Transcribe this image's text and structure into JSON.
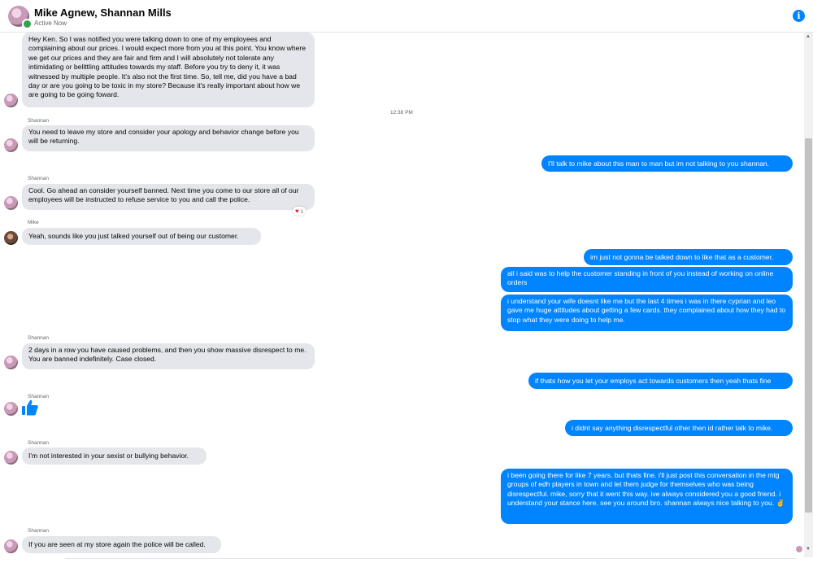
{
  "header": {
    "title": "Mike Agnew, Shannan Mills",
    "status": "Active Now",
    "info_icon": "info-icon"
  },
  "timestamp": "12:38 PM",
  "messages": {
    "m1": "Hey Ken. So I was notified you were talking down to one of my employees and complaining about our prices. I would expect more from you at this point. You know where we get our prices and they are fair and firm and I will absolutely not tolerate any intimidating or belittling attitudes towards my staff. Before you try to deny it, it was witnessed by multiple people. It's also not the first time. So, tell me, did you have a bad day or are you going to be toxic in my store? Because it's really important about how we are going to be going foward.",
    "m2_sender": "Shannan",
    "m2": "You need to leave my store and consider your apology and behavior change before you will be returning.",
    "m3": "I'll talk to mike about this man to man but im not talking to you shannan.",
    "m4_sender": "Shannan",
    "m4": "Cool. Go ahead an consider yourself banned. Next time you come to our store all of our employees will be instructed to refuse service to you and call the police.",
    "m4_reaction_count": "1",
    "m5_sender": "Mike",
    "m5": "Yeah, sounds like you just talked yourself out of being our customer.",
    "m6": "im just not gonna be talked down to like that as a customer.",
    "m7": "all i said was to help the customer standing in front of you instead of working on online orders",
    "m8": "i understand your wife doesnt like me but the last 4 times i was in there cyprian and leo gave me huge attitudes about getting a few cards. they complained about how they had to stop what they were doing to help me.",
    "m9_sender": "Shannan",
    "m9": "2 days in a row you have caused problems, and then you show massive disrespect to me. You are banned indefinitely. Case closed.",
    "m10": "if thats how you let your employs act towards customers then yeah thats fine",
    "m11_sender": "Shannan",
    "m12": "i didnt say anything disrespectful other then id rather talk to mike.",
    "m13_sender": "Shannan",
    "m13": "I'm not interested in your sexist or bullying behavior.",
    "m14": "i been going there for like 7 years. but thats fine. i'll just post this conversation in the mtg groups of edh players in town and let them judge for themselves who was being disrespectful. mike, sorry that it went this way. ive always considered you a good friend. i understand your stance here. see you around bro. shannan always nice talking to you. ✌",
    "m15_sender": "Shannan",
    "m15": "If you are seen at my store again the police will be called."
  },
  "colors": {
    "outgoing": "#0084ff",
    "incoming": "#e4e6eb",
    "heart": "#e41e3f"
  }
}
